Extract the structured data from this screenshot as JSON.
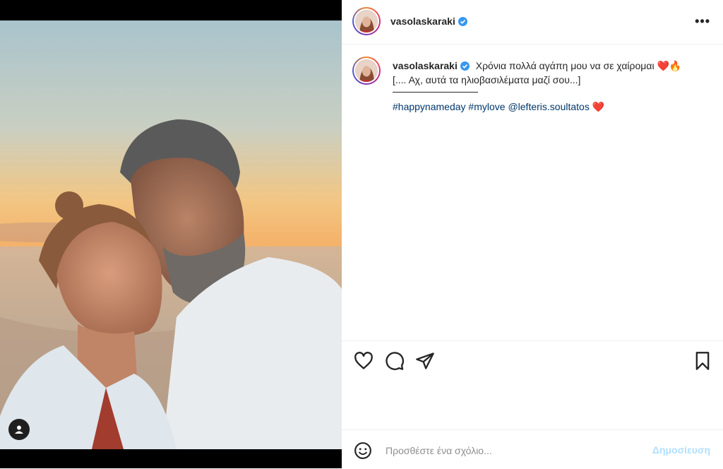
{
  "post": {
    "username": "vasolaskaraki",
    "verified_icon": "verified-badge-icon",
    "more_icon": "more-options-icon"
  },
  "caption": {
    "username": "vasolaskaraki",
    "line1": "Χρόνια πολλά αγάπη μου να σε χαίρομαι ❤️🔥",
    "line2": "[.... Αχ, αυτά τα ηλιοβασιλέματα μαζί σου...]",
    "hashtags": [
      "#happynameday",
      "#mylove",
      "@lefteris.soultatos"
    ],
    "hashtag_suffix": "❤️"
  },
  "actions": {
    "like_icon": "heart-icon",
    "comment_icon": "comment-icon",
    "share_icon": "share-icon",
    "save_icon": "bookmark-icon"
  },
  "comment": {
    "placeholder": "Προσθέστε ένα σχόλιο...",
    "post_label": "Δημοσίευση",
    "emoji_icon": "emoji-icon"
  },
  "media": {
    "tag_icon": "user-tag-icon"
  },
  "colors": {
    "link": "#00376b",
    "verified": "#3897f0",
    "post_button_disabled": "#b2dffc"
  }
}
